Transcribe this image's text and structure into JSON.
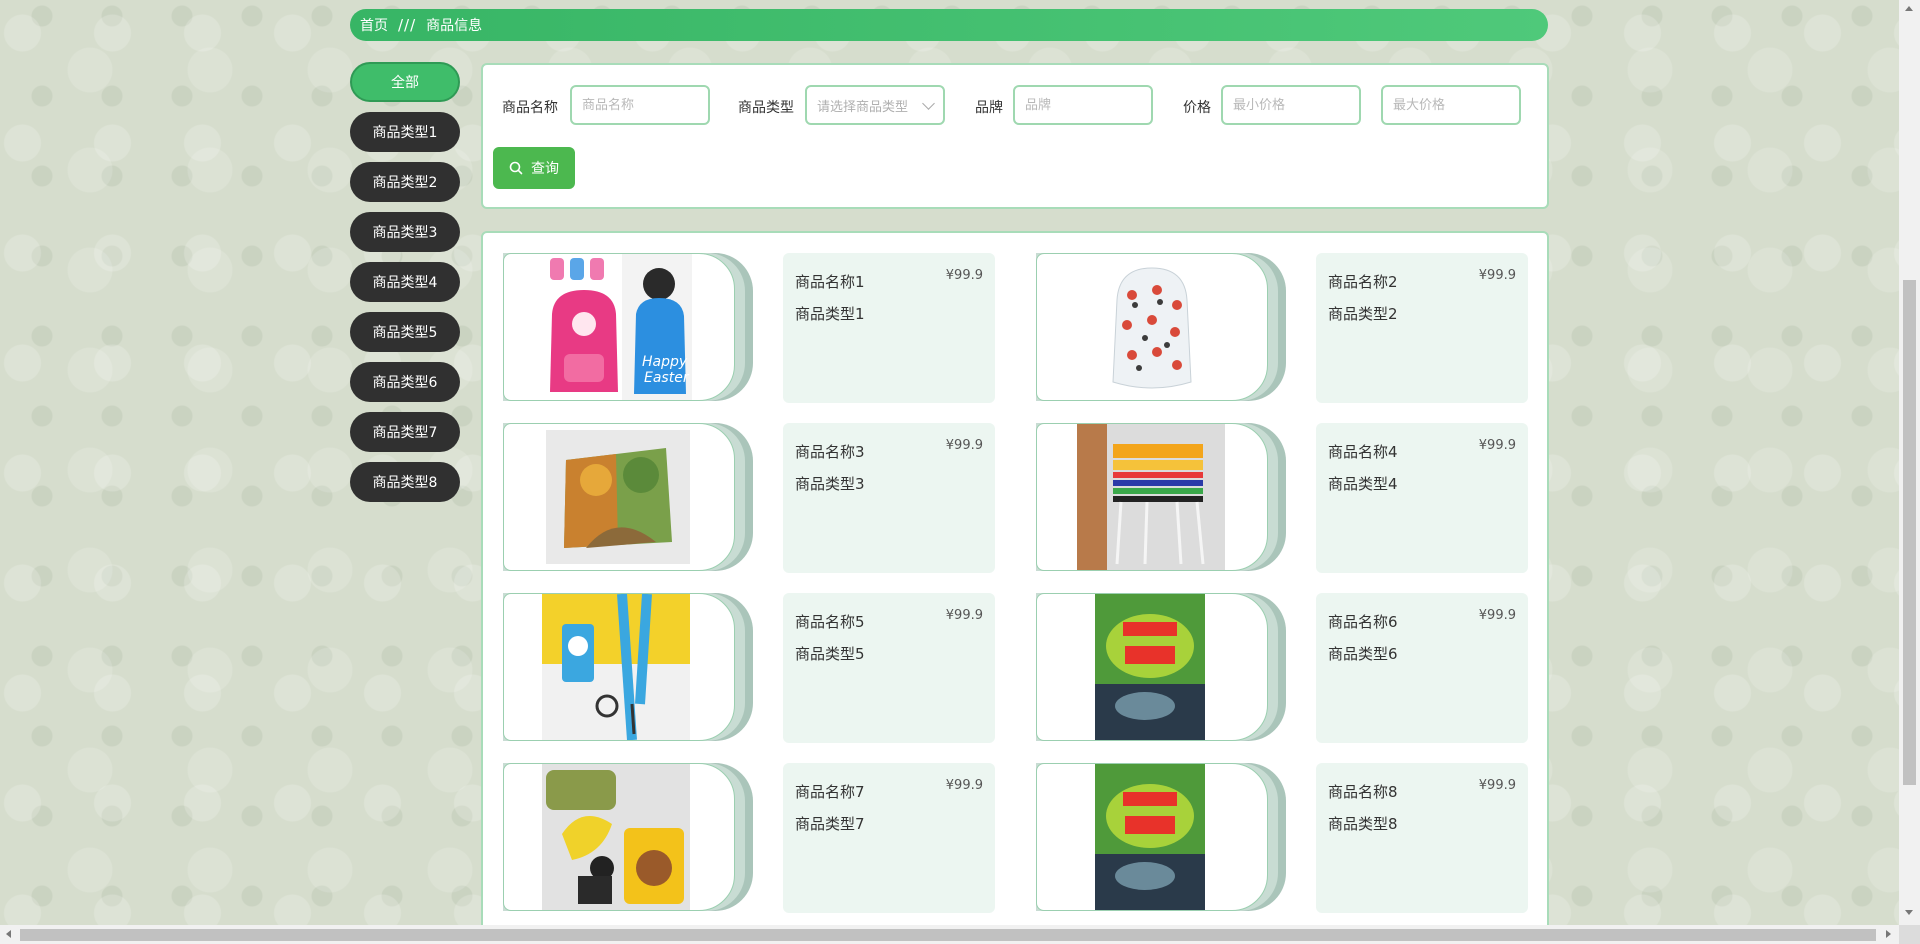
{
  "breadcrumb": {
    "home": "首页",
    "separator": "///",
    "current": "商品信息"
  },
  "categories": [
    {
      "label": "全部",
      "active": true
    },
    {
      "label": "商品类型1"
    },
    {
      "label": "商品类型2"
    },
    {
      "label": "商品类型3"
    },
    {
      "label": "商品类型4"
    },
    {
      "label": "商品类型5"
    },
    {
      "label": "商品类型6"
    },
    {
      "label": "商品类型7"
    },
    {
      "label": "商品类型8"
    }
  ],
  "search": {
    "name_label": "商品名称",
    "name_placeholder": "商品名称",
    "type_label": "商品类型",
    "type_placeholder": "请选择商品类型",
    "brand_label": "品牌",
    "brand_placeholder": "品牌",
    "price_label": "价格",
    "min_price_placeholder": "最小价格",
    "max_price_placeholder": "最大价格",
    "query_label": "查询"
  },
  "products": [
    {
      "name": "商品名称1",
      "type": "商品类型1",
      "price": "¥99.9",
      "image": "backpack-pink-blue"
    },
    {
      "name": "商品名称2",
      "type": "商品类型2",
      "price": "¥99.9",
      "image": "backpack-cartoon"
    },
    {
      "name": "商品名称3",
      "type": "商品类型3",
      "price": "¥99.9",
      "image": "autumn-card"
    },
    {
      "name": "商品名称4",
      "type": "商品类型4",
      "price": "¥99.9",
      "image": "stacked-chairs"
    },
    {
      "name": "商品名称5",
      "type": "商品类型5",
      "price": "¥99.9",
      "image": "lanyard-card-holder"
    },
    {
      "name": "商品名称6",
      "type": "商品类型6",
      "price": "¥99.9",
      "image": "book-cover"
    },
    {
      "name": "商品名称7",
      "type": "商品类型7",
      "price": "¥99.9",
      "image": "keychain-bear-wallet"
    },
    {
      "name": "商品名称8",
      "type": "商品类型8",
      "price": "¥99.9",
      "image": "book-cover"
    }
  ],
  "icons": {
    "query": "search-icon",
    "select": "chevron-down-icon"
  },
  "colors": {
    "accent": "#3fbd6a",
    "dark_button": "#303030",
    "panel_border": "#a8dcb9",
    "info_bg": "#ecf6f1"
  }
}
